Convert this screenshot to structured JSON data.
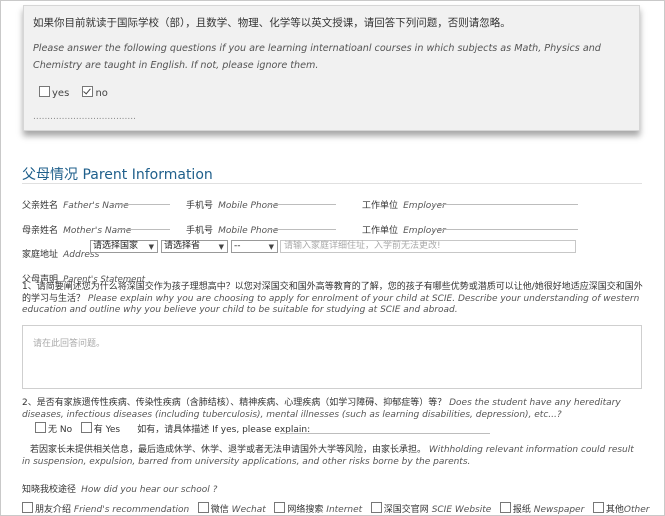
{
  "notice": {
    "zh": "如果你目前就读于国际学校（部），且数学、物理、化学等以英文授课，请回答下列问题，否则请忽略。",
    "en": "Please answer the following questions if you are learning internatioanl courses in which subjects as Math, Physics and Chemistry are taught in English. If not, please ignore them.",
    "yes_label": "yes",
    "no_label": "no",
    "yes_checked": false,
    "no_checked": true,
    "dots": "...................................."
  },
  "section": {
    "title": "父母情况 Parent Information"
  },
  "fields": {
    "father_name": {
      "zh": "父亲姓名",
      "en": "Father's Name"
    },
    "father_phone": {
      "zh": "手机号",
      "en": "Mobile Phone"
    },
    "father_employer": {
      "zh": "工作单位",
      "en": "Employer"
    },
    "mother_name": {
      "zh": "母亲姓名",
      "en": "Mother's Name"
    },
    "mother_phone": {
      "zh": "手机号",
      "en": "Mobile Phone"
    },
    "mother_employer": {
      "zh": "工作单位",
      "en": "Employer"
    },
    "address": {
      "zh": "家庭地址",
      "en": "Address"
    }
  },
  "address_selects": {
    "country": "请选择国家",
    "province": "请选择省",
    "city": "--",
    "detail_placeholder": "请输入家庭详细住址，入学前无法更改!"
  },
  "statement": {
    "zh": "父母声明",
    "en": "Parent's Statement",
    "q1_zh": "1、请简要阐述您为什么将深国交作为孩子理想高中？以您对深国交和国外高等教育的了解，您的孩子有哪些优势或潜质可以让他/她很好地适应深国交和国外的学习与生活？",
    "q1_en": "Please explain why you are choosing to apply for enrolment of your child at SCIE. Describe your understanding of western education and outline why you believe your child to be suitable for studying at SCIE and abroad.",
    "answer_placeholder": "请在此回答问题。",
    "q2_zh": "2、是否有家族遗传性疾病、传染性疾病（含肺结核）、精神疾病、心理疾病（如学习障碍、抑郁症等）等？",
    "q2_en": "Does the student have any hereditary diseases, infectious diseases (including tuberculosis), mental illnesses (such as learning disabilities, depression), etc...?",
    "no_label": "无 No",
    "yes_label": "有 Yes",
    "explain_label": "如有，请具体描述 If yes, please explain:",
    "warning_zh": "若因家长未提供相关信息，最后造成休学、休学、退学或者无法申请国外大学等风险，由家长承担。",
    "warning_en": "Withholding relevant information could result in suspension, expulsion, barred from university applications, and other risks borne by the parents."
  },
  "source": {
    "zh": "知晓我校途径",
    "en": "How did you hear our school ?",
    "options": [
      {
        "zh": "朋友介绍",
        "en": "Friend's recommendation"
      },
      {
        "zh": "微信",
        "en": "Wechat"
      },
      {
        "zh": "网络搜索",
        "en": "Internet"
      },
      {
        "zh": "深国交官网",
        "en": "SCIE Website"
      },
      {
        "zh": "报纸",
        "en": "Newspaper"
      },
      {
        "zh": "其他",
        "en": "Other"
      }
    ]
  }
}
